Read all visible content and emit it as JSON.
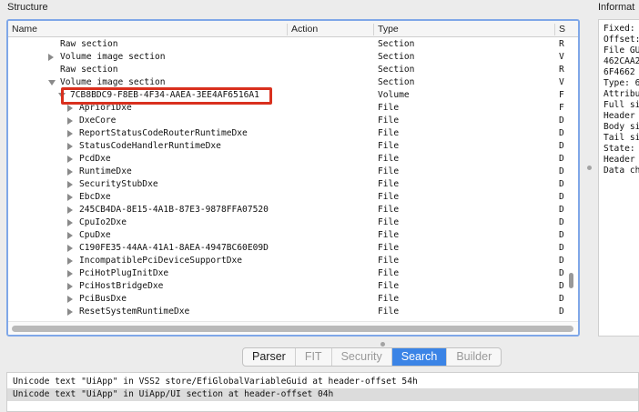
{
  "panels": {
    "structure": "Structure",
    "info": "Informat"
  },
  "columns": {
    "name": "Name",
    "action": "Action",
    "type": "Type",
    "subtype": "S"
  },
  "rows": [
    {
      "name": "Raw section",
      "type": "Section",
      "sub": "R"
    },
    {
      "name": "Volume image section",
      "type": "Section",
      "sub": "V"
    },
    {
      "name": "Raw section",
      "type": "Section",
      "sub": "R"
    },
    {
      "name": "Volume image section",
      "type": "Section",
      "sub": "V"
    },
    {
      "name": "7CB8BDC9-F8EB-4F34-AAEA-3EE4AF6516A1",
      "type": "Volume",
      "sub": "F"
    },
    {
      "name": "AprioriDxe",
      "type": "File",
      "sub": "F"
    },
    {
      "name": "DxeCore",
      "type": "File",
      "sub": "D"
    },
    {
      "name": "ReportStatusCodeRouterRuntimeDxe",
      "type": "File",
      "sub": "D"
    },
    {
      "name": "StatusCodeHandlerRuntimeDxe",
      "type": "File",
      "sub": "D"
    },
    {
      "name": "PcdDxe",
      "type": "File",
      "sub": "D"
    },
    {
      "name": "RuntimeDxe",
      "type": "File",
      "sub": "D"
    },
    {
      "name": "SecurityStubDxe",
      "type": "File",
      "sub": "D"
    },
    {
      "name": "EbcDxe",
      "type": "File",
      "sub": "D"
    },
    {
      "name": "245CB4DA-8E15-4A1B-87E3-9878FFA07520",
      "type": "File",
      "sub": "D"
    },
    {
      "name": "CpuIo2Dxe",
      "type": "File",
      "sub": "D"
    },
    {
      "name": "CpuDxe",
      "type": "File",
      "sub": "D"
    },
    {
      "name": "C190FE35-44AA-41A1-8AEA-4947BC60E09D",
      "type": "File",
      "sub": "D"
    },
    {
      "name": "IncompatiblePciDeviceSupportDxe",
      "type": "File",
      "sub": "D"
    },
    {
      "name": "PciHotPlugInitDxe",
      "type": "File",
      "sub": "D"
    },
    {
      "name": "PciHostBridgeDxe",
      "type": "File",
      "sub": "D"
    },
    {
      "name": "PciBusDxe",
      "type": "File",
      "sub": "D"
    },
    {
      "name": "ResetSystemRuntimeDxe",
      "type": "File",
      "sub": "D"
    }
  ],
  "info_lines": [
    "Fixed:",
    "Offset:",
    "File GU",
    "462CAA2",
    "6F4662",
    "Type: 6",
    "Attribu",
    "Full si",
    "Header",
    "Body si",
    "Tail si",
    "State:",
    "Header",
    "Data ch"
  ],
  "tabs": [
    {
      "label": "Parser",
      "state": "enabled"
    },
    {
      "label": "FIT",
      "state": "disabled"
    },
    {
      "label": "Security",
      "state": "disabled"
    },
    {
      "label": "Search",
      "state": "active"
    },
    {
      "label": "Builder",
      "state": "disabled"
    }
  ],
  "results": [
    "Unicode text \"UiApp\" in VSS2 store/EfiGlobalVariableGuid at header-offset 54h",
    "Unicode text \"UiApp\" in UiApp/UI section at header-offset 04h"
  ],
  "colors": {
    "accent": "#3b84e6",
    "highlight": "#d9301e"
  }
}
